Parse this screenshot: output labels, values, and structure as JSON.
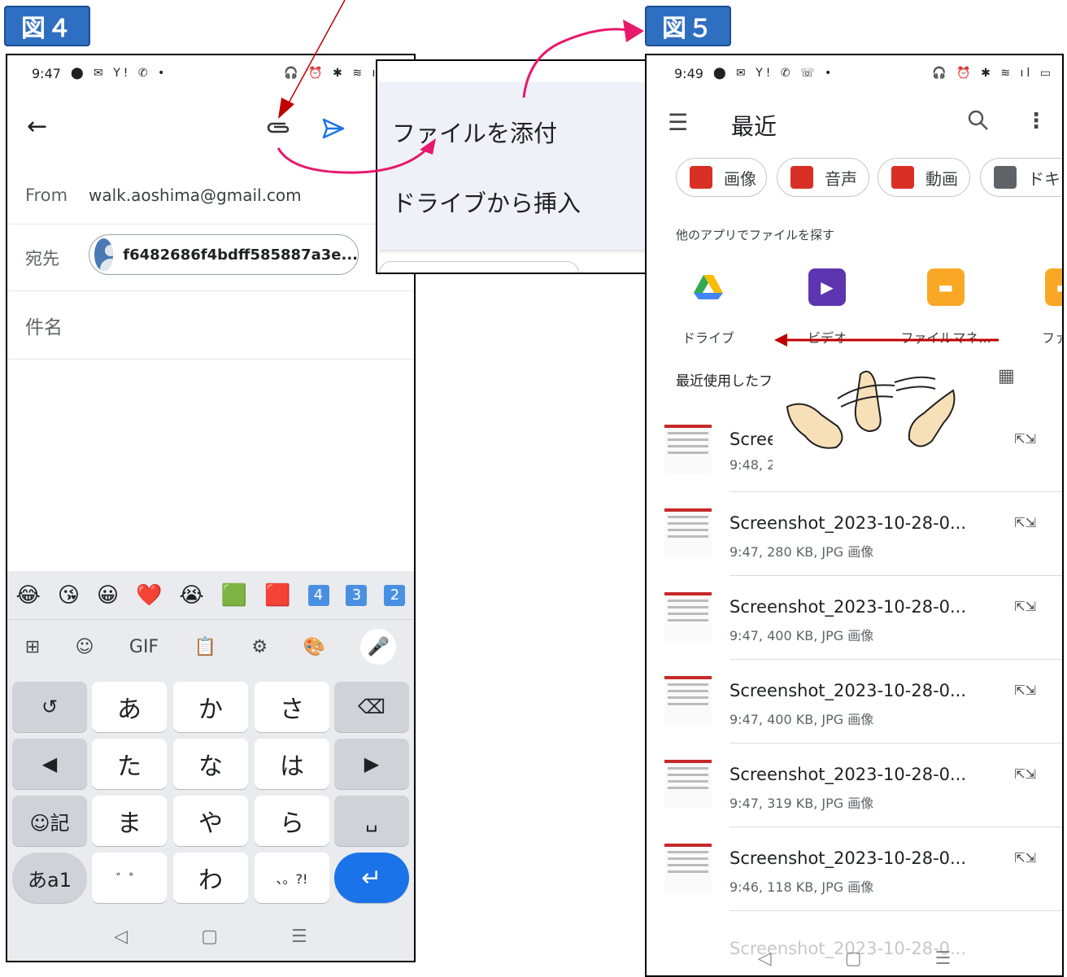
{
  "fig4": {
    "label": "図４",
    "status": {
      "time": "9:47",
      "icons": "⬤ ✉ Y! ✆ •",
      "right": "🎧 ⏰ ✱ ≋ ıl ▭"
    },
    "toolbar": {
      "back": "←",
      "attach": "📎",
      "send": "▷"
    },
    "from": {
      "label": "From",
      "value": "walk.aoshima@gmail.com"
    },
    "to": {
      "label": "宛先",
      "chip": "f6482686f4bdff585887a3e..."
    },
    "subject": {
      "label": "件名"
    },
    "keyboard": {
      "emojis": [
        "😂",
        "😘",
        "😀",
        "❤️",
        "😭",
        "🟩",
        "🟥",
        "4",
        "3",
        "2"
      ],
      "tools": [
        "⊞",
        "☺",
        "GIF",
        "📋",
        "⚙",
        "🎨",
        "🎤"
      ],
      "rows": [
        [
          "↺",
          "あ",
          "か",
          "さ",
          "⌫"
        ],
        [
          "◀",
          "た",
          "な",
          "は",
          "▶"
        ],
        [
          "☺記",
          "ま",
          "や",
          "ら",
          "␣"
        ],
        [
          "あa1",
          "゛゜",
          "わ",
          "、。?!",
          "↵"
        ]
      ],
      "nav": [
        "◁",
        "▢",
        "☰"
      ]
    }
  },
  "popup": {
    "item1": "ファイルを添付",
    "item2": "ドライブから挿入"
  },
  "fig5": {
    "label": "図５",
    "status": {
      "time": "9:49",
      "icons": "⬤ ✉ Y! ✆ ☏ •",
      "right": "🎧 ⏰ ✱ ≋ ıl ▭"
    },
    "title": "最近",
    "chips": [
      "画像",
      "音声",
      "動画",
      "ドキ"
    ],
    "other_apps_label": "他のアプリでファイルを探す",
    "apps": [
      "ドライブ",
      "ビデオ",
      "ファイルマネ...",
      "ファイ"
    ],
    "recent_label": "最近使用したフ",
    "files": [
      {
        "name": "Scree",
        "meta": "9:48, 2"
      },
      {
        "name": "Screenshot_2023-10-28-0...",
        "meta": "9:47, 280 KB, JPG 画像"
      },
      {
        "name": "Screenshot_2023-10-28-0...",
        "meta": "9:47, 400 KB, JPG 画像"
      },
      {
        "name": "Screenshot_2023-10-28-0...",
        "meta": "9:47, 400 KB, JPG 画像"
      },
      {
        "name": "Screenshot_2023-10-28-0...",
        "meta": "9:47, 319 KB, JPG 画像"
      },
      {
        "name": "Screenshot_2023-10-28-0...",
        "meta": "9:46, 118 KB, JPG 画像"
      }
    ],
    "faded_file": "Screenshot_2023-10-28-0...",
    "nav": [
      "◁",
      "▢",
      "☰"
    ]
  },
  "colors": {
    "accent": "#2f6fc1",
    "arrow_pink": "#e8186c",
    "arrow_red": "#c00000",
    "send_blue": "#1a73e8"
  }
}
